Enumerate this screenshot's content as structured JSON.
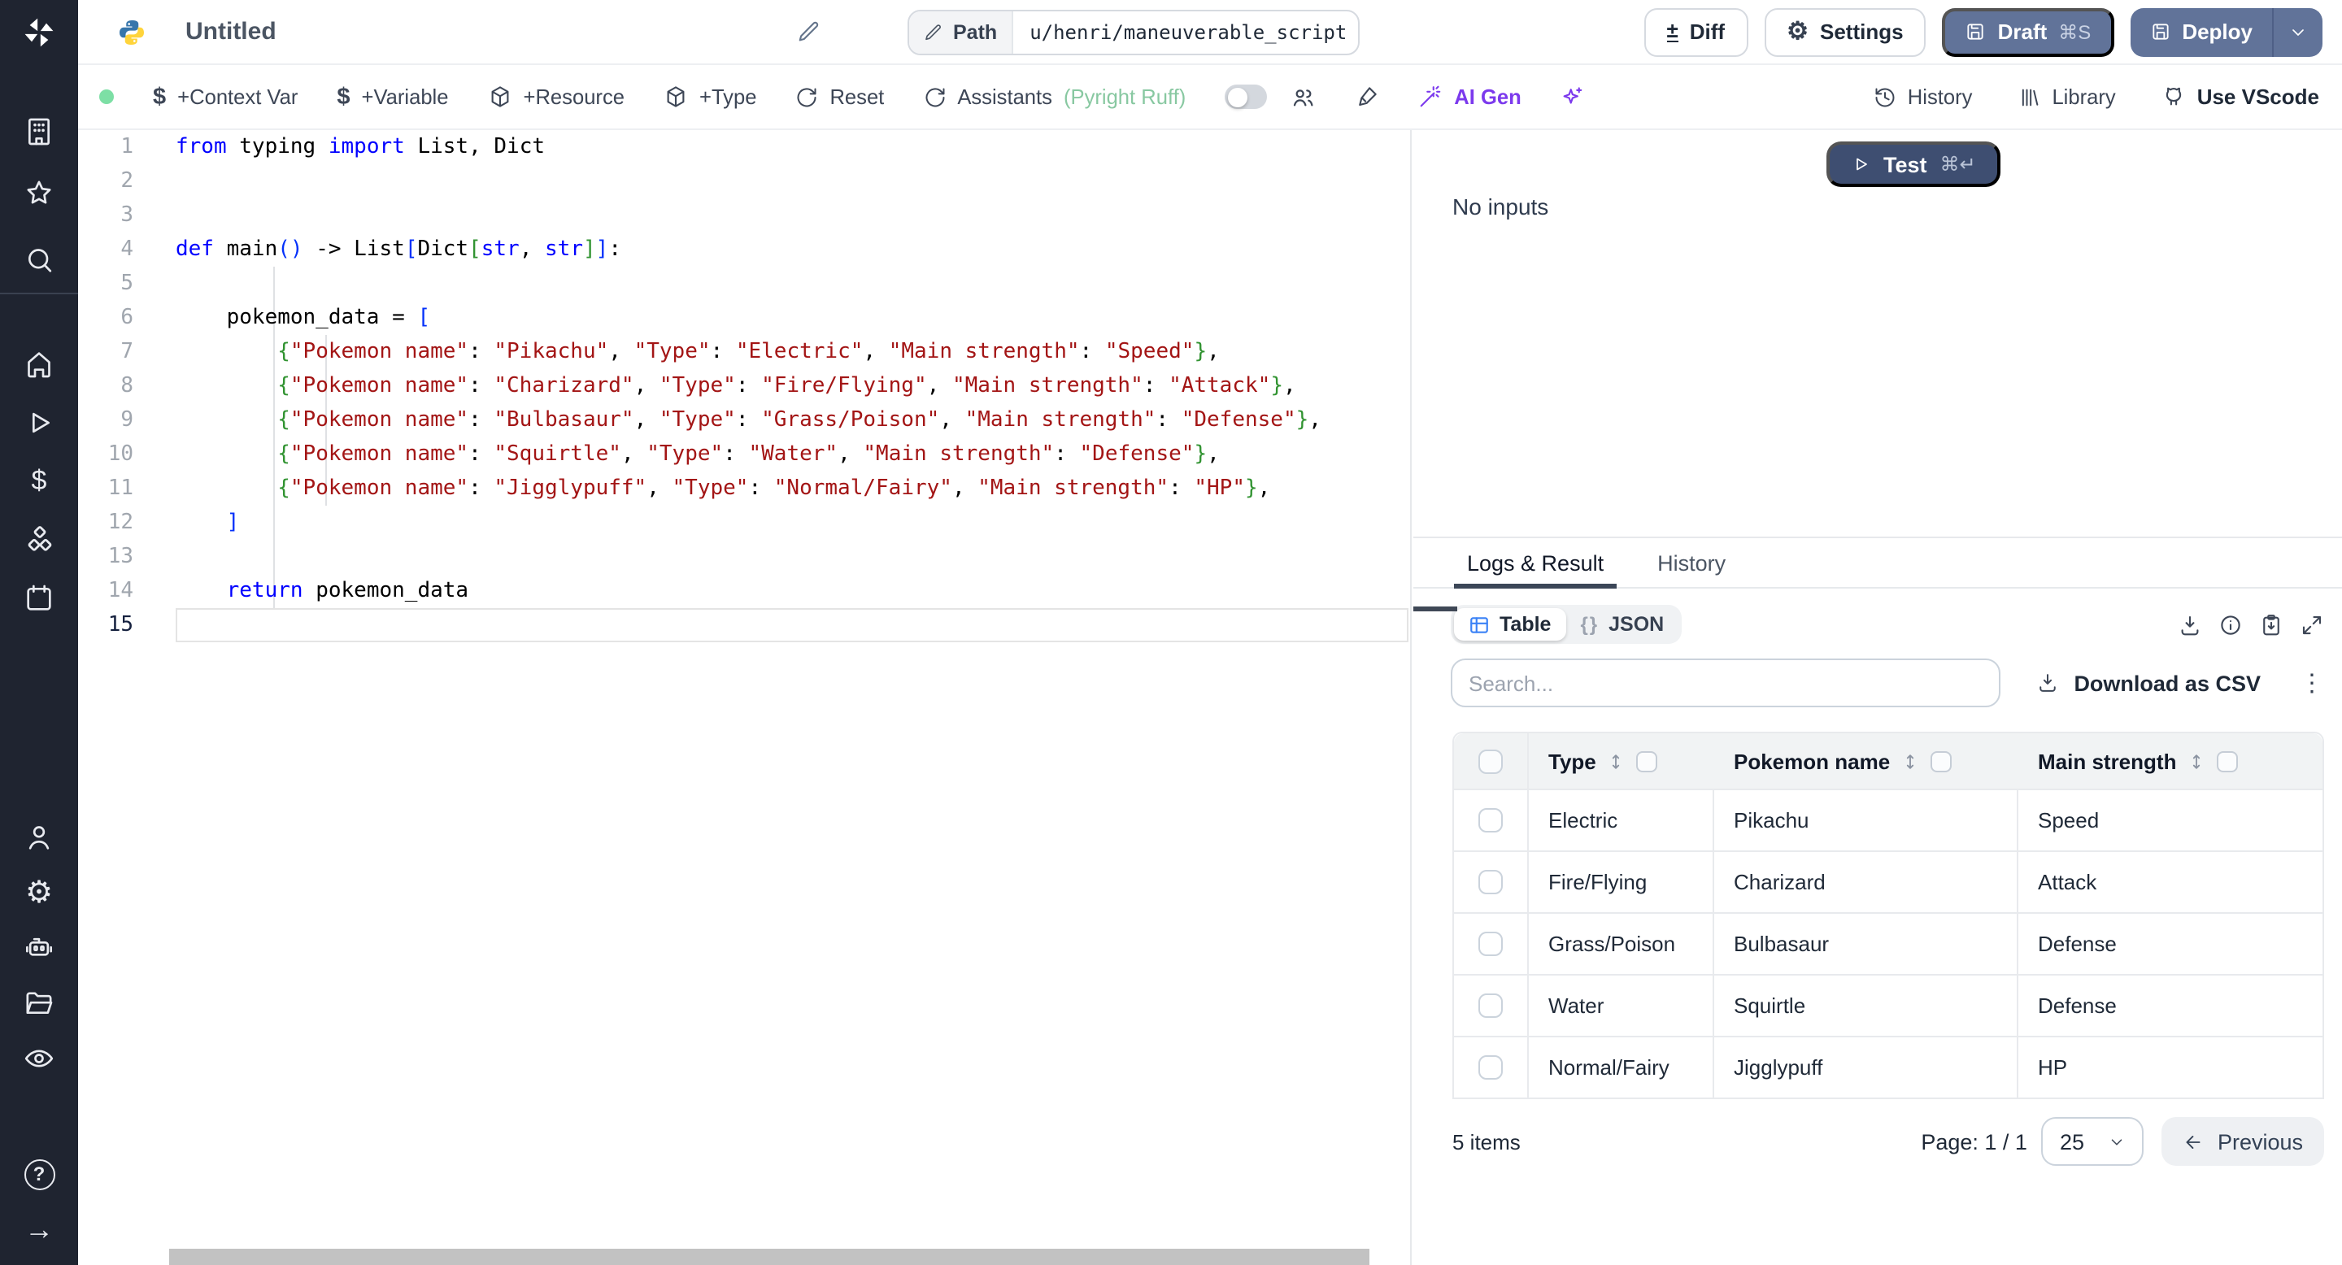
{
  "topbar": {
    "title": "Untitled",
    "path_label": "Path",
    "path_value": "u/henri/maneuverable_script",
    "diff_label": "Diff",
    "settings_label": "Settings",
    "draft_label": "Draft",
    "draft_shortcut": "⌘S",
    "deploy_label": "Deploy"
  },
  "toolbar": {
    "context_var": "+Context Var",
    "variable": "+Variable",
    "resource": "+Resource",
    "type": "+Type",
    "reset": "Reset",
    "assistants": "Assistants",
    "assistants_detail": "(Pyright Ruff)",
    "ai_gen": "AI Gen",
    "history": "History",
    "library": "Library",
    "use_vscode": "Use VScode"
  },
  "glyphs": {
    "gear": "⚙",
    "plus_minus": "±",
    "dollar": "$",
    "kebab": "⋮",
    "braces": "{}",
    "arrow_right": "→",
    "question": "?"
  },
  "editor": {
    "active_line": 15,
    "lines": [
      [
        [
          "k",
          "from"
        ],
        [
          "p",
          " typing "
        ],
        [
          "k",
          "import"
        ],
        [
          "p",
          " List, Dict"
        ]
      ],
      [],
      [],
      [
        [
          "k",
          "def"
        ],
        [
          "p",
          " main"
        ],
        [
          "b1",
          "()"
        ],
        [
          "p",
          " -> List"
        ],
        [
          "b1",
          "["
        ],
        [
          "p",
          "Dict"
        ],
        [
          "b2",
          "["
        ],
        [
          "k",
          "str"
        ],
        [
          "p",
          ", "
        ],
        [
          "k",
          "str"
        ],
        [
          "b2",
          "]"
        ],
        [
          "b1",
          "]"
        ],
        [
          "p",
          ":"
        ]
      ],
      [],
      [
        [
          "p",
          "    pokemon_data = "
        ],
        [
          "b1",
          "["
        ]
      ],
      [
        [
          "p",
          "        "
        ],
        [
          "b2",
          "{"
        ],
        [
          "s",
          "\"Pokemon name\""
        ],
        [
          "p",
          ": "
        ],
        [
          "s",
          "\"Pikachu\""
        ],
        [
          "p",
          ", "
        ],
        [
          "s",
          "\"Type\""
        ],
        [
          "p",
          ": "
        ],
        [
          "s",
          "\"Electric\""
        ],
        [
          "p",
          ", "
        ],
        [
          "s",
          "\"Main strength\""
        ],
        [
          "p",
          ": "
        ],
        [
          "s",
          "\"Speed\""
        ],
        [
          "b2",
          "}"
        ],
        [
          "p",
          ","
        ]
      ],
      [
        [
          "p",
          "        "
        ],
        [
          "b2",
          "{"
        ],
        [
          "s",
          "\"Pokemon name\""
        ],
        [
          "p",
          ": "
        ],
        [
          "s",
          "\"Charizard\""
        ],
        [
          "p",
          ", "
        ],
        [
          "s",
          "\"Type\""
        ],
        [
          "p",
          ": "
        ],
        [
          "s",
          "\"Fire/Flying\""
        ],
        [
          "p",
          ", "
        ],
        [
          "s",
          "\"Main strength\""
        ],
        [
          "p",
          ": "
        ],
        [
          "s",
          "\"Attack\""
        ],
        [
          "b2",
          "}"
        ],
        [
          "p",
          ","
        ]
      ],
      [
        [
          "p",
          "        "
        ],
        [
          "b2",
          "{"
        ],
        [
          "s",
          "\"Pokemon name\""
        ],
        [
          "p",
          ": "
        ],
        [
          "s",
          "\"Bulbasaur\""
        ],
        [
          "p",
          ", "
        ],
        [
          "s",
          "\"Type\""
        ],
        [
          "p",
          ": "
        ],
        [
          "s",
          "\"Grass/Poison\""
        ],
        [
          "p",
          ", "
        ],
        [
          "s",
          "\"Main strength\""
        ],
        [
          "p",
          ": "
        ],
        [
          "s",
          "\"Defense\""
        ],
        [
          "b2",
          "}"
        ],
        [
          "p",
          ","
        ]
      ],
      [
        [
          "p",
          "        "
        ],
        [
          "b2",
          "{"
        ],
        [
          "s",
          "\"Pokemon name\""
        ],
        [
          "p",
          ": "
        ],
        [
          "s",
          "\"Squirtle\""
        ],
        [
          "p",
          ", "
        ],
        [
          "s",
          "\"Type\""
        ],
        [
          "p",
          ": "
        ],
        [
          "s",
          "\"Water\""
        ],
        [
          "p",
          ", "
        ],
        [
          "s",
          "\"Main strength\""
        ],
        [
          "p",
          ": "
        ],
        [
          "s",
          "\"Defense\""
        ],
        [
          "b2",
          "}"
        ],
        [
          "p",
          ","
        ]
      ],
      [
        [
          "p",
          "        "
        ],
        [
          "b2",
          "{"
        ],
        [
          "s",
          "\"Pokemon name\""
        ],
        [
          "p",
          ": "
        ],
        [
          "s",
          "\"Jigglypuff\""
        ],
        [
          "p",
          ", "
        ],
        [
          "s",
          "\"Type\""
        ],
        [
          "p",
          ": "
        ],
        [
          "s",
          "\"Normal/Fairy\""
        ],
        [
          "p",
          ", "
        ],
        [
          "s",
          "\"Main strength\""
        ],
        [
          "p",
          ": "
        ],
        [
          "s",
          "\"HP\""
        ],
        [
          "b2",
          "}"
        ],
        [
          "p",
          ","
        ]
      ],
      [
        [
          "p",
          "    "
        ],
        [
          "b1",
          "]"
        ]
      ],
      [],
      [
        [
          "p",
          "    "
        ],
        [
          "k",
          "return"
        ],
        [
          "p",
          " pokemon_data"
        ]
      ],
      []
    ]
  },
  "preview": {
    "test_label": "Test",
    "test_shortcut": "⌘↵",
    "no_inputs": "No inputs",
    "tabs": [
      "Logs & Result",
      "History"
    ],
    "view_table": "Table",
    "view_json": "JSON",
    "search_placeholder": "Search...",
    "download_csv": "Download as CSV",
    "table": {
      "columns": [
        "Type",
        "Pokemon name",
        "Main strength"
      ],
      "rows": [
        [
          "Electric",
          "Pikachu",
          "Speed"
        ],
        [
          "Fire/Flying",
          "Charizard",
          "Attack"
        ],
        [
          "Grass/Poison",
          "Bulbasaur",
          "Defense"
        ],
        [
          "Water",
          "Squirtle",
          "Defense"
        ],
        [
          "Normal/Fairy",
          "Jigglypuff",
          "HP"
        ]
      ]
    },
    "footer": {
      "items": "5 items",
      "page": "Page: 1 / 1",
      "page_size": "25",
      "previous": "Previous"
    }
  },
  "colors": {
    "sidebar_bg": "#1f2430",
    "primary_button": "#617399",
    "test_button": "#3e4e71",
    "accent_purple": "#7c3aed",
    "status_green": "#7ddfa5",
    "table_icon_blue": "#3b82f6",
    "code_keyword": "#0000ff",
    "code_string": "#a31515",
    "code_bracket1": "#0431fa",
    "code_bracket2": "#319331"
  }
}
